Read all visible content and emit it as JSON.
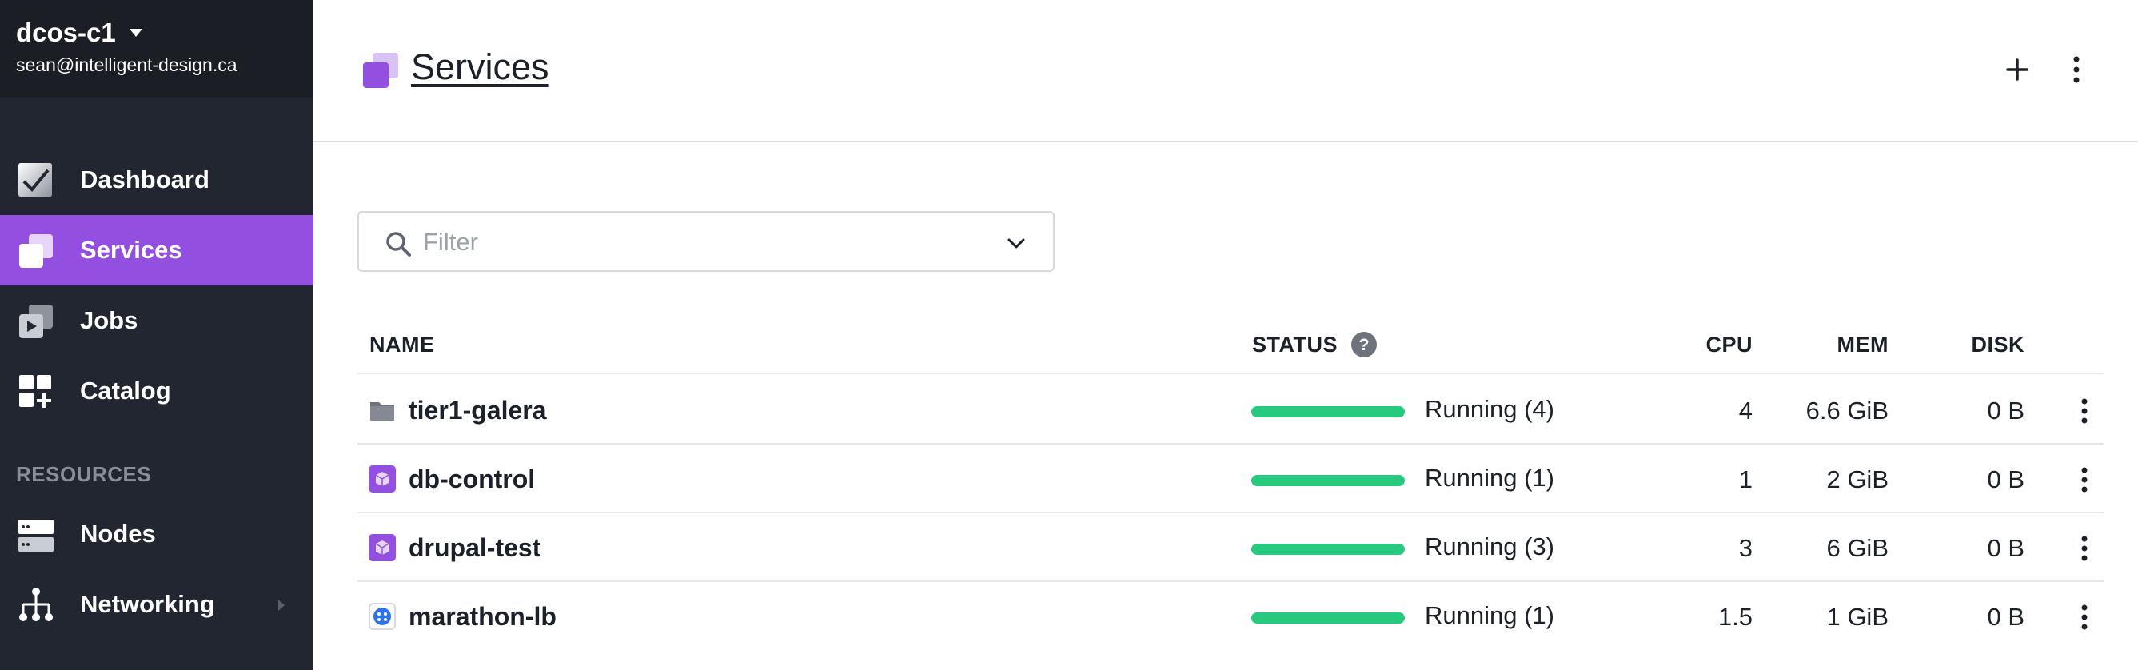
{
  "cluster": {
    "name": "dcos-c1",
    "user": "sean@intelligent-design.ca"
  },
  "sidebar": {
    "items": [
      {
        "label": "Dashboard"
      },
      {
        "label": "Services"
      },
      {
        "label": "Jobs"
      },
      {
        "label": "Catalog"
      }
    ],
    "section_label": "RESOURCES",
    "resource_items": [
      {
        "label": "Nodes"
      },
      {
        "label": "Networking"
      }
    ]
  },
  "header": {
    "title": "Services"
  },
  "filter": {
    "placeholder": "Filter",
    "value": ""
  },
  "table": {
    "columns": {
      "name": "NAME",
      "status": "STATUS",
      "cpu": "CPU",
      "mem": "MEM",
      "disk": "DISK"
    },
    "rows": [
      {
        "name": "tier1-galera",
        "type": "group",
        "status": "Running (4)",
        "progress": 1.0,
        "cpu": "4",
        "mem": "6.6 GiB",
        "disk": "0 B"
      },
      {
        "name": "db-control",
        "type": "service",
        "status": "Running (1)",
        "progress": 1.0,
        "cpu": "1",
        "mem": "2 GiB",
        "disk": "0 B"
      },
      {
        "name": "drupal-test",
        "type": "service",
        "status": "Running (3)",
        "progress": 1.0,
        "cpu": "3",
        "mem": "6 GiB",
        "disk": "0 B"
      },
      {
        "name": "marathon-lb",
        "type": "package",
        "status": "Running (1)",
        "progress": 1.0,
        "cpu": "1.5",
        "mem": "1 GiB",
        "disk": "0 B"
      }
    ]
  },
  "colors": {
    "accent": "#9350e0",
    "sidebar": "#222630",
    "running": "#27c97f"
  }
}
